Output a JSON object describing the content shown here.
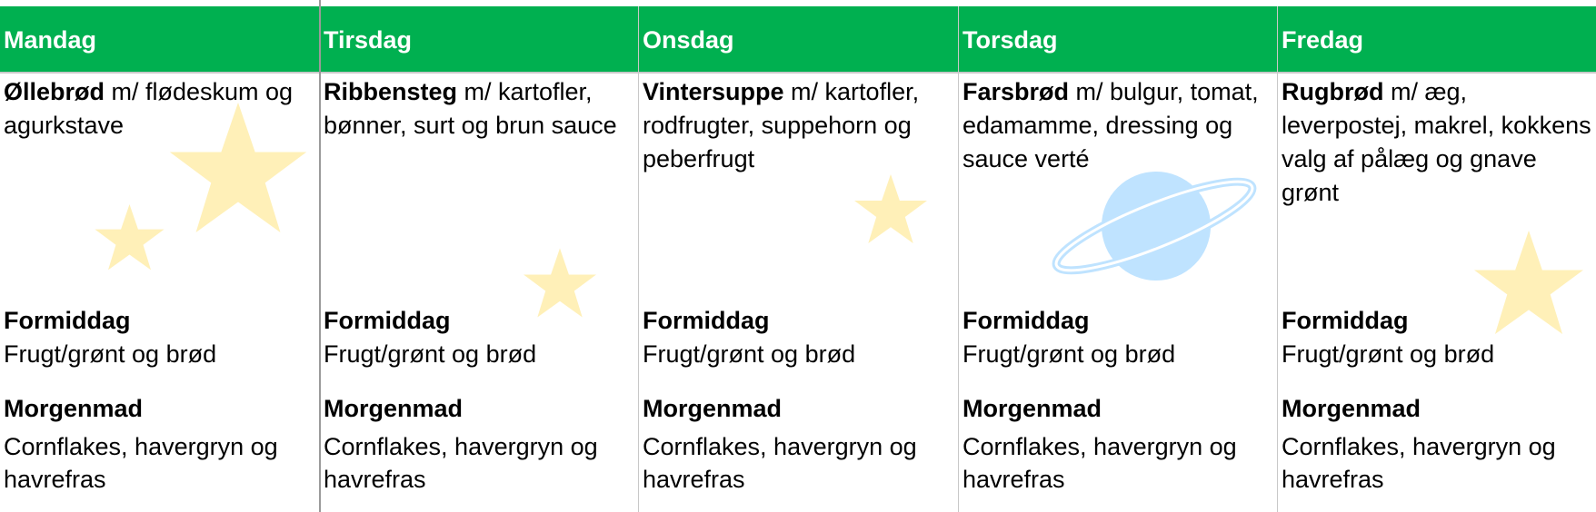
{
  "colors": {
    "header_bg": "#00b050",
    "header_text": "#ffffff",
    "star": "#fff0b8",
    "planet": "#bfe3ff"
  },
  "days": [
    {
      "name": "Mandag",
      "lunch_dish": "Øllebrød",
      "lunch_rest": " m/ flødeskum og agurkstave",
      "snack_title": "Formiddag",
      "snack_text": "Frugt/grønt og brød",
      "breakfast_title": "Morgenmad",
      "breakfast_text": "Cornflakes, havergryn og havrefras"
    },
    {
      "name": "Tirsdag",
      "lunch_dish": "Ribbensteg",
      "lunch_rest": " m/ kartofler, bønner, surt og brun sauce",
      "snack_title": "Formiddag",
      "snack_text": "Frugt/grønt og brød",
      "breakfast_title": "Morgenmad",
      "breakfast_text": "Cornflakes, havergryn og havrefras"
    },
    {
      "name": "Onsdag",
      "lunch_dish": "Vintersuppe",
      "lunch_rest": " m/ kartofler, rodfrugter, suppehorn og peberfrugt",
      "snack_title": "Formiddag",
      "snack_text": "Frugt/grønt og brød",
      "breakfast_title": "Morgenmad",
      "breakfast_text": "Cornflakes, havergryn og havrefras"
    },
    {
      "name": "Torsdag",
      "lunch_dish": "Farsbrød",
      "lunch_rest": " m/ bulgur, tomat, edamamme, dressing og sauce verté",
      "snack_title": "Formiddag",
      "snack_text": "Frugt/grønt og brød",
      "breakfast_title": "Morgenmad",
      "breakfast_text": "Cornflakes, havergryn og havrefras"
    },
    {
      "name": "Fredag",
      "lunch_dish": "Rugbrød",
      "lunch_rest": " m/ æg, leverpostej, makrel, kokkens valg af pålæg og gnave grønt",
      "snack_title": "Formiddag",
      "snack_text": "Frugt/grønt og brød",
      "breakfast_title": "Morgenmad",
      "breakfast_text": "Cornflakes, havergryn og havrefras"
    }
  ],
  "decorations": [
    {
      "icon": "star-icon"
    },
    {
      "icon": "star-icon"
    },
    {
      "icon": "star-icon"
    },
    {
      "icon": "star-icon"
    },
    {
      "icon": "planet-icon"
    },
    {
      "icon": "star-icon"
    }
  ]
}
